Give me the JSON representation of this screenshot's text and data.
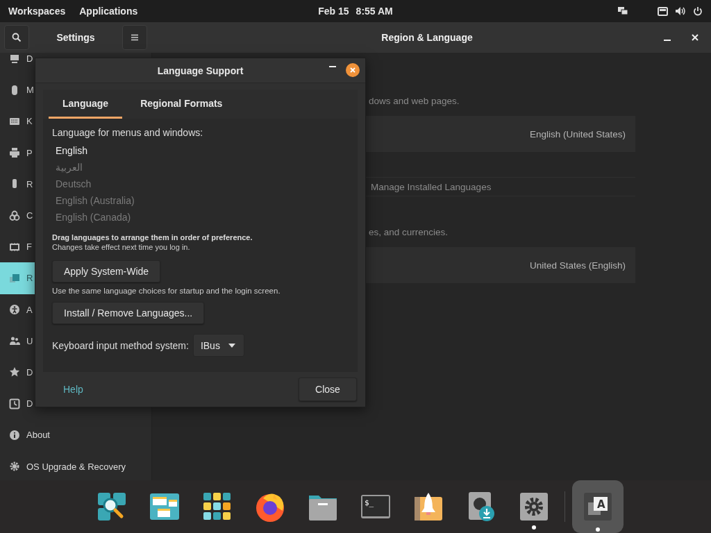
{
  "top_bar": {
    "workspaces": "Workspaces",
    "applications": "Applications",
    "date": "Feb 15",
    "time": "8:55 AM"
  },
  "settings_window": {
    "sidebar_title": "Settings",
    "title": "Region & Language",
    "sidebar": {
      "items": [
        {
          "label": "D",
          "kind": "display",
          "selected": false
        },
        {
          "label": "M",
          "kind": "mouse",
          "selected": false
        },
        {
          "label": "K",
          "kind": "keyboard",
          "selected": false
        },
        {
          "label": "P",
          "kind": "printer",
          "selected": false
        },
        {
          "label": "R",
          "kind": "drive",
          "selected": false
        },
        {
          "label": "C",
          "kind": "circles",
          "selected": false
        },
        {
          "label": "F",
          "kind": "chip",
          "selected": false
        },
        {
          "label": "R",
          "kind": "language",
          "selected": true
        },
        {
          "label": "A",
          "kind": "accessibility",
          "selected": false
        },
        {
          "label": "U",
          "kind": "users",
          "selected": false
        },
        {
          "label": "D",
          "kind": "star",
          "selected": false
        },
        {
          "label": "D",
          "kind": "clock",
          "selected": false
        },
        {
          "label": "About",
          "kind": "info",
          "selected": false
        },
        {
          "label": "OS Upgrade & Recovery",
          "kind": "gear",
          "selected": false
        }
      ]
    },
    "main": {
      "language_hint": "dows and web pages.",
      "language_value": "English (United States)",
      "manage_button": "Manage Installed Languages",
      "formats_hint": "es, and currencies.",
      "formats_value": "United States (English)"
    }
  },
  "dialog": {
    "title": "Language Support",
    "tabs": [
      {
        "label": "Language",
        "selected": true
      },
      {
        "label": "Regional Formats",
        "selected": false
      }
    ],
    "list_label": "Language for menus and windows:",
    "languages": [
      {
        "label": "English",
        "dimmed": false
      },
      {
        "label": "العربية",
        "dimmed": true
      },
      {
        "label": "Deutsch",
        "dimmed": true
      },
      {
        "label": "English (Australia)",
        "dimmed": true
      },
      {
        "label": "English (Canada)",
        "dimmed": true
      }
    ],
    "note_bold": "Drag languages to arrange them in order of preference.",
    "note": "Changes take effect next time you log in.",
    "apply_button": "Apply System-Wide",
    "apply_hint": "Use the same language choices for startup and the login screen.",
    "install_button": "Install / Remove Languages...",
    "input_method_label": "Keyboard input method system:",
    "input_method_value": "IBus",
    "help_link": "Help",
    "close_button": "Close"
  },
  "dock": {
    "items": [
      {
        "kind": "search",
        "running": false,
        "selected": false
      },
      {
        "kind": "windows",
        "running": false,
        "selected": false
      },
      {
        "kind": "grid",
        "running": false,
        "selected": false
      },
      {
        "kind": "browser",
        "running": false,
        "selected": false
      },
      {
        "kind": "folder",
        "running": false,
        "selected": false
      },
      {
        "kind": "terminal",
        "glyph": "$_",
        "running": false,
        "selected": false
      },
      {
        "kind": "rocket",
        "running": false,
        "selected": false
      },
      {
        "kind": "download",
        "running": false,
        "selected": false
      },
      {
        "kind": "settings",
        "running": true,
        "selected": false
      },
      {
        "kind": "language",
        "glyph": "A",
        "running": true,
        "selected": true
      }
    ]
  }
}
